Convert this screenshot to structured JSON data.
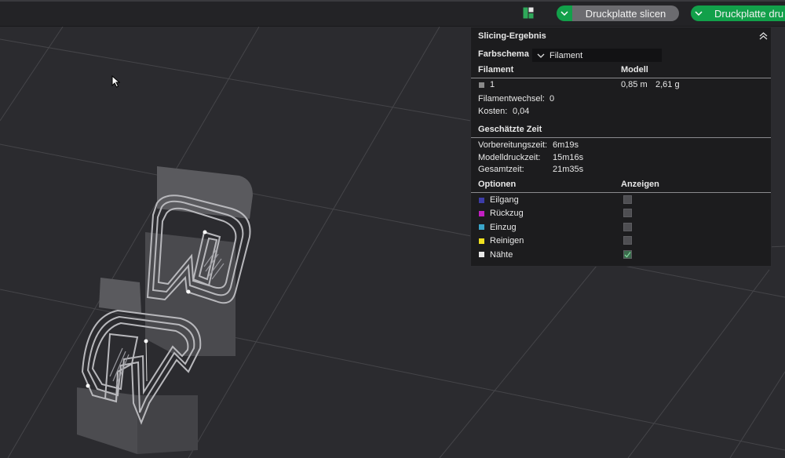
{
  "toolbar": {
    "slice_button": "Druckplatte slicen",
    "print_button": "Druckplatte dru"
  },
  "panel": {
    "title": "Slicing-Ergebnis",
    "color_scheme_label": "Farbschema",
    "color_scheme_value": "Filament",
    "filament_header": "Filament",
    "model_header": "Modell",
    "filament_row": {
      "id": "1",
      "length": "0,85 m",
      "weight": "2,61 g",
      "color": "#8a8a8a"
    },
    "filament_changes_label": "Filamentwechsel:",
    "filament_changes_value": "0",
    "cost_label": "Kosten:",
    "cost_value": "0,04",
    "time_header": "Geschätzte Zeit",
    "prep_time_label": "Vorbereitungszeit:",
    "prep_time_value": "6m19s",
    "model_time_label": "Modelldruckzeit:",
    "model_time_value": "15m16s",
    "total_time_label": "Gesamtzeit:",
    "total_time_value": "21m35s",
    "options_header": "Optionen",
    "show_header": "Anzeigen",
    "options": [
      {
        "label": "Eilgang",
        "color": "#3c3ca8",
        "checked": false
      },
      {
        "label": "Rückzug",
        "color": "#c21fc2",
        "checked": false
      },
      {
        "label": "Einzug",
        "color": "#3aa5c9",
        "checked": false
      },
      {
        "label": "Reinigen",
        "color": "#f0e020",
        "checked": false
      },
      {
        "label": "Nähte",
        "color": "#e8e8e8",
        "checked": true
      }
    ]
  }
}
